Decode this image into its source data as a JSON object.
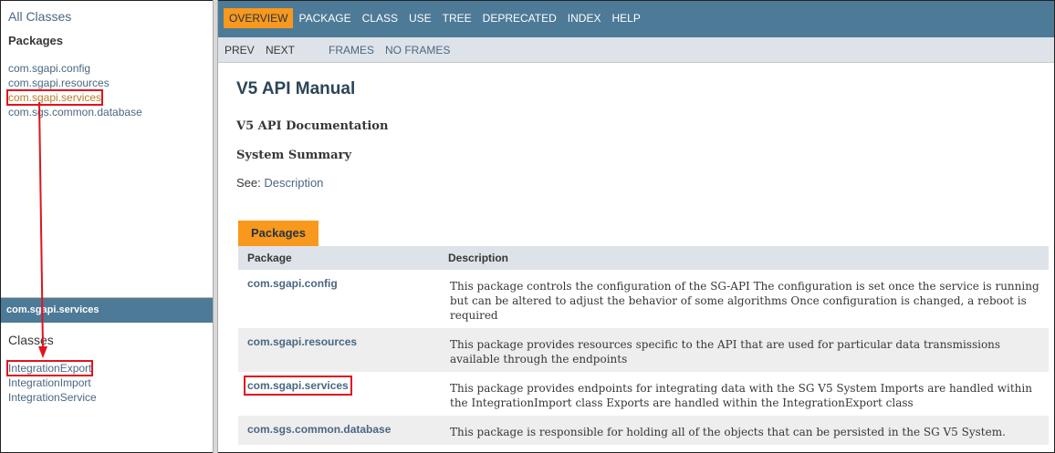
{
  "left_top": {
    "all_classes": "All Classes",
    "packages_heading": "Packages",
    "packages": [
      "com.sgapi.config",
      "com.sgapi.resources",
      "com.sgapi.services",
      "com.sgs.common.database"
    ]
  },
  "left_bottom": {
    "package_name": "com.sgapi.services",
    "classes_heading": "Classes",
    "classes": [
      "IntegrationExport",
      "IntegrationImport",
      "IntegrationService"
    ]
  },
  "topnav": {
    "items": [
      "OVERVIEW",
      "PACKAGE",
      "CLASS",
      "USE",
      "TREE",
      "DEPRECATED",
      "INDEX",
      "HELP"
    ]
  },
  "subnav": {
    "prev": "PREV",
    "next": "NEXT",
    "frames": "FRAMES",
    "no_frames": "NO FRAMES"
  },
  "main": {
    "title": "V5 API Manual",
    "doc_title": "V5 API Documentation",
    "system_summary": "System Summary",
    "see_label": "See:",
    "see_link": "Description",
    "packages_tab": "Packages",
    "table": {
      "headers": [
        "Package",
        "Description"
      ],
      "rows": [
        {
          "package": "com.sgapi.config",
          "description": "This package controls the configuration of the SG-API The configuration is set once the service is running but can be altered to adjust the behavior of some algorithms Once configuration is changed, a reboot is required"
        },
        {
          "package": "com.sgapi.resources",
          "description": "This package provides resources specific to the API that are used for particular data transmissions available through the endpoints"
        },
        {
          "package": "com.sgapi.services",
          "description": "This package provides endpoints for integrating data with the SG V5 System Imports are handled within the IntegrationImport class Exports are handled within the IntegrationExport class"
        },
        {
          "package": "com.sgs.common.database",
          "description": "This package is responsible for holding all of the objects that can be persisted in the SG V5 System."
        }
      ]
    }
  },
  "colors": {
    "nav_bg": "#4d7a97",
    "accent_orange": "#f8981d",
    "link": "#4a6782",
    "annotation_red": "#e0141e"
  }
}
